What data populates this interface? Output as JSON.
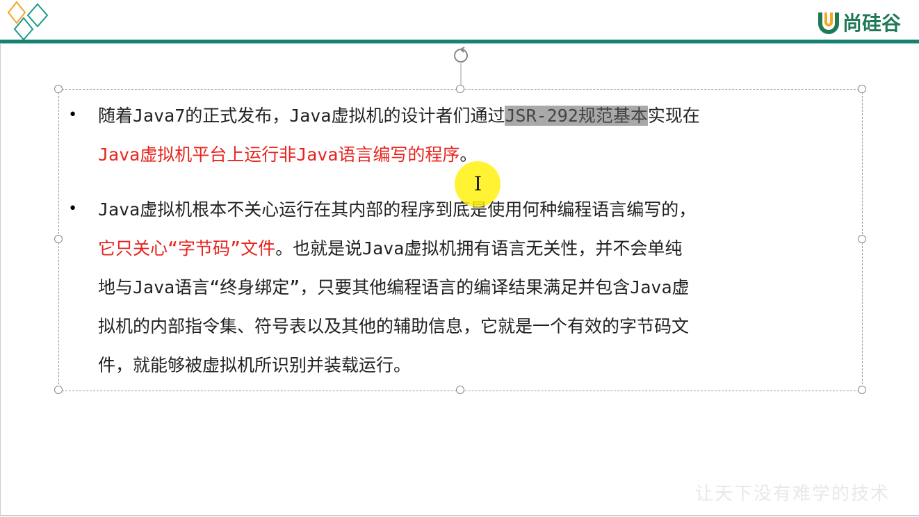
{
  "header": {
    "logo_text": "尚硅谷",
    "accent": "#17826f"
  },
  "slide": {
    "para1": {
      "l1a": "随着Java7的正式发布，Java虚拟机的设计者们通过",
      "l1hl": "JSR-292规范基本",
      "l1b": "实现在",
      "l2red": "Java虚拟机平台上运行非Java语言编写的程序",
      "l2b": "。"
    },
    "para2": {
      "l1": "Java虚拟机根本不关心运行在其内部的程序到底是使用何种编程语言编写的，",
      "l2red": "它只关心“字节码”文件",
      "l2b": "。也就是说Java虚拟机拥有语言无关性，并不会单纯",
      "l3": "地与Java语言“终身绑定”，只要其他编程语言的编译结果满足并包含Java虚",
      "l4": "拟机的内部指令集、符号表以及其他的辅助信息，它就是一个有效的字节码文",
      "l5": "件，就能够被虚拟机所识别并装载运行。"
    },
    "bullet": "•",
    "slogan": "让天下没有难学的技术",
    "red": "#e8231e"
  }
}
